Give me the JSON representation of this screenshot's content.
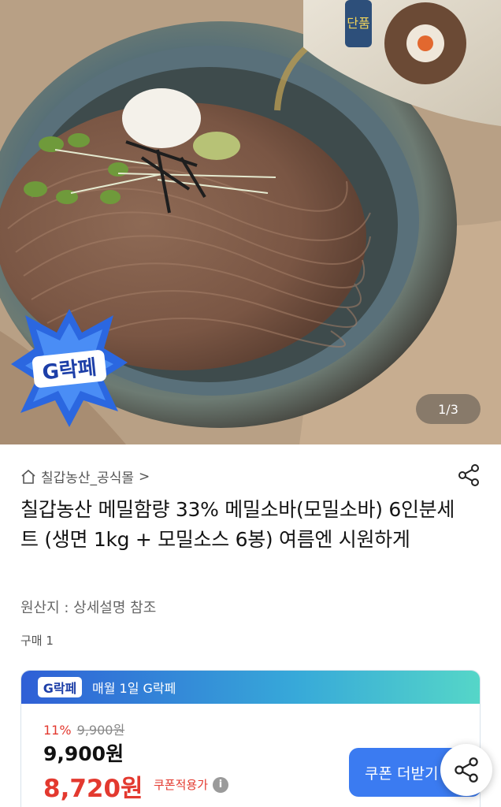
{
  "hero": {
    "image_counter": "1/3",
    "badge_text": "G락페",
    "pack_text": "단품"
  },
  "product": {
    "shop_name": "칠갑농산_공식몰",
    "shop_chevron": ">",
    "title": "칠갑농산 메밀함량 33% 메밀소바(모밀소바) 6인분세트 (생면 1kg + 모밀소스 6봉) 여름엔 시원하게",
    "origin": "원산지 : 상세설명 참조",
    "purchase_count": "구매 1"
  },
  "deal": {
    "badge_text": "G락페",
    "banner_text": "매월 1일 G락페",
    "discount_percent": "11%",
    "original_price": "9,900원",
    "price": "9,900원",
    "coupon_price": "8,720원",
    "coupon_label": "쿠폰적용가",
    "info_glyph": "i",
    "coupon_button": "쿠폰 더받기"
  },
  "colors": {
    "accent_blue": "#3b7bf1",
    "sale_red": "#e3392f"
  }
}
